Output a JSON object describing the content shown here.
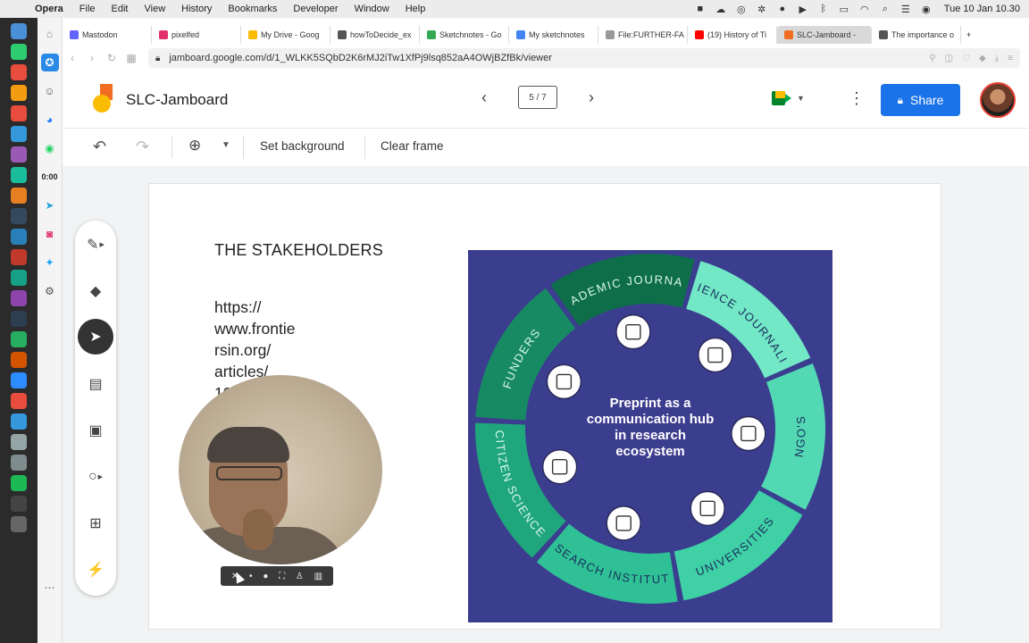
{
  "menubar": {
    "app": "Opera",
    "items": [
      "File",
      "Edit",
      "View",
      "History",
      "Bookmarks",
      "Developer",
      "Window",
      "Help"
    ],
    "clock": "Tue 10 Jan  10.30"
  },
  "opera_sidebar": {
    "timer": "0:00"
  },
  "tabs": [
    {
      "label": "Mastodon",
      "color": "#6364ff"
    },
    {
      "label": "pixelfed",
      "color": "#e1306c"
    },
    {
      "label": "My Drive - Goog",
      "color": "#fbbc04"
    },
    {
      "label": "howToDecide_ex",
      "color": "#555555"
    },
    {
      "label": "Sketchnotes - Go",
      "color": "#34a853"
    },
    {
      "label": "My sketchnotes",
      "color": "#4285f4"
    },
    {
      "label": "File:FURTHER-FA",
      "color": "#999999"
    },
    {
      "label": "(19) History of Ti",
      "color": "#ff0000"
    },
    {
      "label": "SLC-Jamboard - ",
      "color": "#f06d22",
      "active": true
    },
    {
      "label": "The importance o",
      "color": "#555555"
    }
  ],
  "address": {
    "url": "jamboard.google.com/d/1_WLKK5SQbD2K6rMJ2iTw1XfPj9lsq852aA4OWjBZfBk/viewer"
  },
  "jamboard": {
    "title": "SLC-Jamboard",
    "frame_counter": "5 / 7",
    "share_label": "Share"
  },
  "toolbar": {
    "set_background": "Set background",
    "clear_frame": "Clear frame"
  },
  "frame": {
    "heading": "THE STAKEHOLDERS",
    "url_text": "https://\nwww.frontie\nrsin.org/\narticles/\n10"
  },
  "diagram": {
    "center_lines": [
      "Preprint as a",
      "communication hub",
      "in research",
      "ecosystem"
    ],
    "segments": [
      {
        "label": "ACADEMIC JOURNALS",
        "color": "#0f6e4a"
      },
      {
        "label": "SCIENCE JOURNALISM",
        "color": "#72e8c6"
      },
      {
        "label": "NGO'S",
        "color": "#52d9b4"
      },
      {
        "label": "UNIVERSITIES",
        "color": "#3fd0a6"
      },
      {
        "label": "RESEARCH INSTITUTES",
        "color": "#2fc195"
      },
      {
        "label": "CITIZEN SCIENCE",
        "color": "#1fa67c"
      },
      {
        "label": "FUNDERS",
        "color": "#178a63"
      }
    ],
    "background": "#3b3d8f"
  }
}
